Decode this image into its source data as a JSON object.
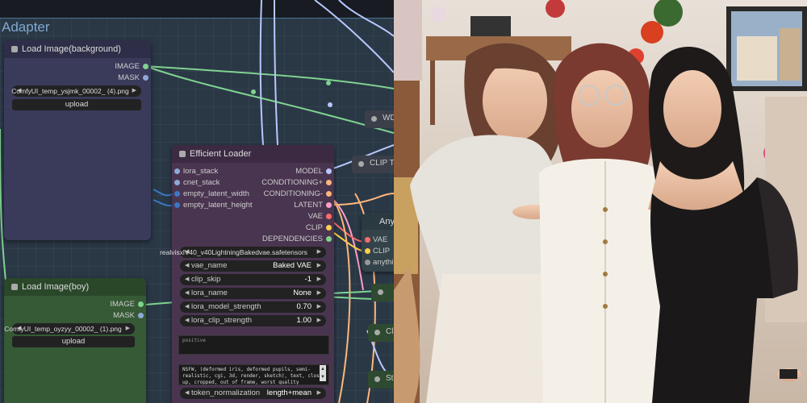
{
  "group": {
    "title": "Adapter"
  },
  "load_bg": {
    "title": "Load Image(background)",
    "outputs": [
      "IMAGE",
      "MASK"
    ],
    "image_value": "ComfyUI_temp_ysjmk_00002_ (4).png",
    "upload_label": "upload"
  },
  "load_boy": {
    "title": "Load Image(boy)",
    "outputs": [
      "IMAGE",
      "MASK"
    ],
    "image_value": "ComfyUI_temp_oyzyy_00002_ (1).png",
    "upload_label": "upload"
  },
  "eff": {
    "title": "Efficient Loader",
    "inputs": [
      "lora_stack",
      "cnet_stack",
      "empty_latent_width",
      "empty_latent_height"
    ],
    "outputs": [
      "MODEL",
      "CONDITIONING+",
      "CONDITIONING-",
      "LATENT",
      "VAE",
      "CLIP",
      "DEPENDENCIES"
    ],
    "ckpt_name": "realvisxlV40_v40LightningBakedvae.safetensors",
    "widgets": [
      {
        "label": "vae_name",
        "value": "Baked VAE"
      },
      {
        "label": "clip_skip",
        "value": "-1"
      },
      {
        "label": "lora_name",
        "value": "None"
      },
      {
        "label": "lora_model_strength",
        "value": "0.70"
      },
      {
        "label": "lora_clip_strength",
        "value": "1.00"
      }
    ],
    "positive_placeholder": "positive",
    "negative_text": "NSFW, (deformed iris, deformed pupils, semi-realistic, cgi, 3d, render, sketch), text, close up, cropped, out of frame, worst quality",
    "token_norm": {
      "label": "token_normalization",
      "value": "length+mean"
    }
  },
  "side_nodes": {
    "wd": "WD",
    "clip_t": "CLIP T",
    "any_title": "Any",
    "any_slots": [
      "VAE",
      "CLIP",
      "anythi"
    ],
    "cl": "Cl",
    "st": "St"
  },
  "colors": {
    "image_wire": "#7fd38f",
    "latent_wire": "#ff9fc8",
    "vae_wire": "#ff6b6b",
    "clip_wire": "#ffd04b",
    "node_purple": "#4a3550",
    "node_green": "#2d4a2d"
  }
}
